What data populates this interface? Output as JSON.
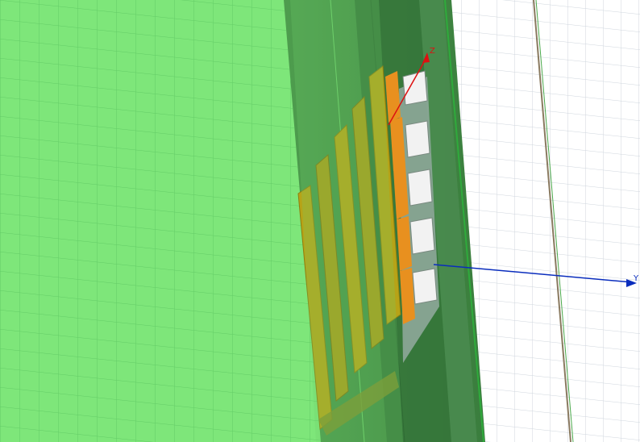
{
  "viewport": {
    "background": "#ffffff",
    "grid_color": "#cfd6dd",
    "substrate_color": "#7ee67a",
    "substrate_grid_color": "#63cc66",
    "wall_color": "#4e9d4e",
    "wall_dark_color": "#2f6b34",
    "green_line_color": "#2faa3c",
    "patch_color": "#b7a317",
    "orange_element_color": "#e8901f",
    "port_color": "#f2f2f2"
  },
  "axes": {
    "z": {
      "label": "Z",
      "color": "#dd1111"
    },
    "y": {
      "label": "Y",
      "color": "#0a2dbd"
    }
  }
}
